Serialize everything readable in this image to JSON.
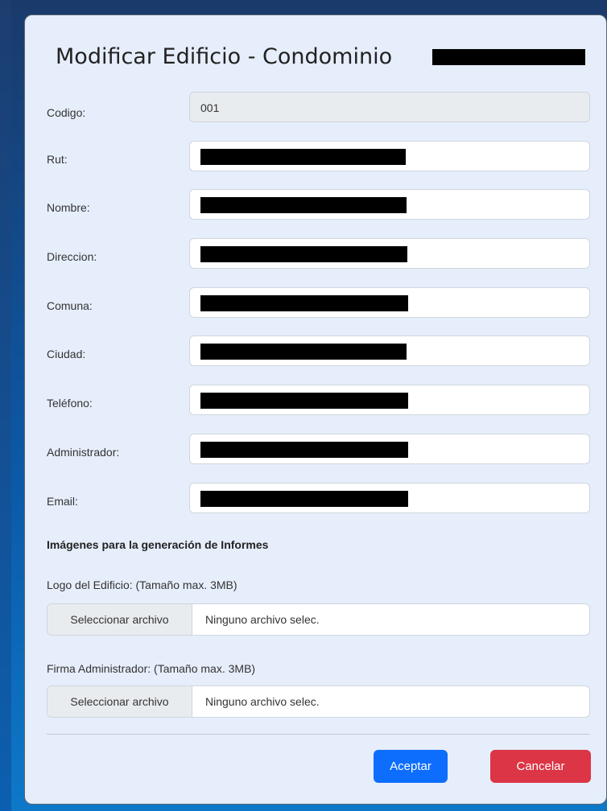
{
  "modal": {
    "title": "Modificar Edificio - Condominio"
  },
  "fields": [
    {
      "label": "Codigo:",
      "value": "001"
    },
    {
      "label": "Rut:"
    },
    {
      "label": "Nombre:"
    },
    {
      "label": "Direccion:"
    },
    {
      "label": "Comuna:"
    },
    {
      "label": "Ciudad:"
    },
    {
      "label": "Teléfono:"
    },
    {
      "label": "Administrador:"
    },
    {
      "label": "Email:"
    }
  ],
  "images_section": {
    "heading": "Imágenes para la generación de Informes",
    "logo": {
      "label": "Logo del Edificio: (Tamaño max. 3MB)",
      "button": "Seleccionar archivo",
      "status": "Ninguno archivo selec."
    },
    "firma": {
      "label": "Firma Administrador: (Tamaño max. 3MB)",
      "button": "Seleccionar archivo",
      "status": "Ninguno archivo selec."
    }
  },
  "actions": {
    "accept": "Aceptar",
    "cancel": "Cancelar"
  }
}
